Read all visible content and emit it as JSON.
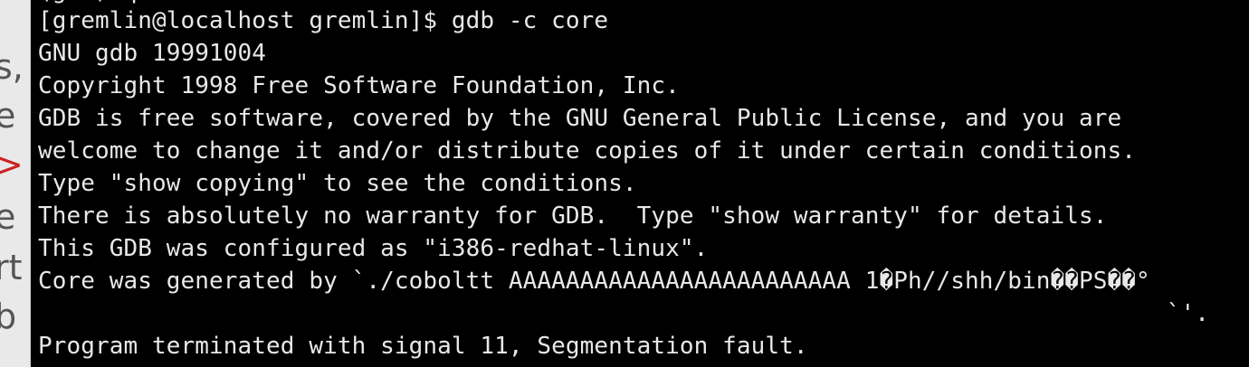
{
  "background_window": {
    "glyphs": [
      "s,",
      "e",
      ">",
      "e",
      "rt",
      "b"
    ],
    "accent_color": "#cc2222"
  },
  "terminal": {
    "partial_line_above": "(gdb) q",
    "lines": [
      "[gremlin@localhost gremlin]$ gdb -c core",
      "GNU gdb 19991004",
      "Copyright 1998 Free Software Foundation, Inc.",
      "GDB is free software, covered by the GNU General Public License, and you are",
      "welcome to change it and/or distribute copies of it under certain conditions.",
      "Type \"show copying\" to see the conditions.",
      "There is absolutely no warranty for GDB.  Type \"show warranty\" for details.",
      "This GDB was configured as \"i386-redhat-linux\".",
      "Core was generated by `./coboltt AAAAAAAAAAAAAAAAAAAAAAAA 1�Ph//shh/bin��PS��°",
      "`'.",
      "Program terminated with signal 11, Segmentation fault."
    ],
    "text_color": "#e8e8e8",
    "background_color": "#000000"
  }
}
